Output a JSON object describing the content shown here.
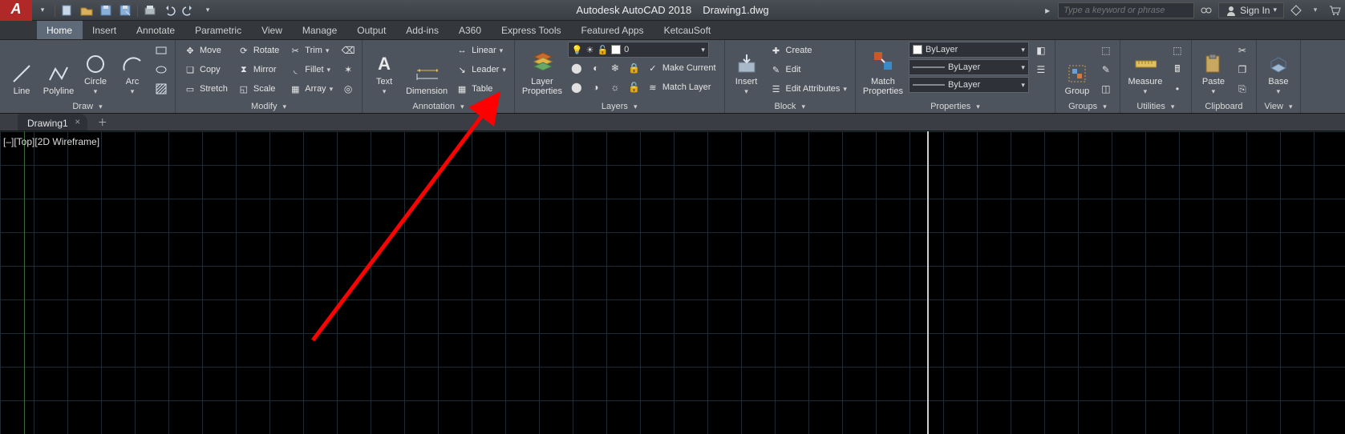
{
  "titlebar": {
    "app_name": "Autodesk AutoCAD 2018",
    "document": "Drawing1.dwg",
    "search_placeholder": "Type a keyword or phrase",
    "signin_label": "Sign In",
    "help_dropdown_glyph": "▸"
  },
  "ribbon_tabs": [
    "Home",
    "Insert",
    "Annotate",
    "Parametric",
    "View",
    "Manage",
    "Output",
    "Add-ins",
    "A360",
    "Express Tools",
    "Featured Apps",
    "KetcauSoft"
  ],
  "active_tab": "Home",
  "panels": {
    "draw": {
      "title": "Draw",
      "line": "Line",
      "polyline": "Polyline",
      "circle": "Circle",
      "arc": "Arc"
    },
    "modify": {
      "title": "Modify",
      "move": "Move",
      "rotate": "Rotate",
      "trim": "Trim",
      "copy": "Copy",
      "mirror": "Mirror",
      "fillet": "Fillet",
      "stretch": "Stretch",
      "scale": "Scale",
      "array": "Array"
    },
    "annotation": {
      "title": "Annotation",
      "text": "Text",
      "dimension": "Dimension",
      "linear": "Linear",
      "leader": "Leader",
      "table": "Table"
    },
    "layers": {
      "title": "Layers",
      "layer_properties": "Layer\nProperties",
      "current_layer": "0",
      "make_current": "Make Current",
      "match_layer": "Match Layer"
    },
    "block": {
      "title": "Block",
      "insert": "Insert",
      "create": "Create",
      "edit": "Edit",
      "edit_attributes": "Edit Attributes"
    },
    "properties": {
      "title": "Properties",
      "match_properties": "Match\nProperties",
      "color": "ByLayer",
      "lineweight": "ByLayer",
      "linetype": "ByLayer"
    },
    "groups": {
      "title": "Groups",
      "group": "Group"
    },
    "utilities": {
      "title": "Utilities",
      "measure": "Measure"
    },
    "clipboard": {
      "title": "Clipboard",
      "paste": "Paste"
    },
    "view": {
      "title": "View",
      "base": "Base"
    }
  },
  "doc_tabs": {
    "active": "Drawing1"
  },
  "viewport": {
    "label": "[–][Top][2D Wireframe]"
  }
}
